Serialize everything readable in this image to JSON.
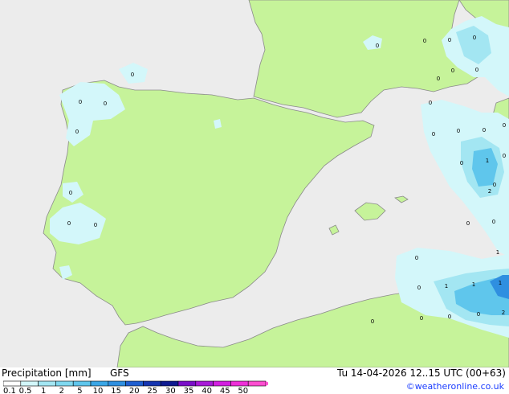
{
  "map": {
    "colors": {
      "sea": "#ececec",
      "land": "#c6f39a",
      "coast": "#8a8a8a",
      "precip_light": "#d3f7fa",
      "precip_1": "#a3e6f2",
      "precip_2": "#5fc6ec",
      "precip_3": "#2f8fe0"
    },
    "value_markers": [
      "0",
      "0",
      "0",
      "0",
      "0",
      "0",
      "0",
      "0",
      "0",
      "0",
      "0",
      "0",
      "0",
      "0",
      "0",
      "0",
      "0",
      "0",
      "0",
      "0",
      "0",
      "0",
      "0",
      "0",
      "0",
      "1",
      "2",
      "0",
      "1",
      "1",
      "1",
      "1",
      "2",
      "0",
      "0",
      "0",
      "0"
    ]
  },
  "footer": {
    "title": "Precipitation [mm]",
    "model": "GFS",
    "timestamp": "Tu 14-04-2026 12..15 UTC (00+63)",
    "credit": "©weatheronline.co.uk",
    "legend": {
      "labels": [
        "0.1",
        "0.5",
        "1",
        "2",
        "5",
        "10",
        "15",
        "20",
        "25",
        "30",
        "35",
        "40",
        "45",
        "50"
      ],
      "colors": [
        "#ffffff",
        "#d3f7fa",
        "#a3e6f2",
        "#7fd8ef",
        "#5fc6ec",
        "#3aa6e6",
        "#2f8fe0",
        "#1f5fd0",
        "#1535b0",
        "#0f1a90",
        "#7a10c8",
        "#a81ad8",
        "#d21ee0",
        "#ee2ed8",
        "#ff4ed0"
      ]
    }
  }
}
